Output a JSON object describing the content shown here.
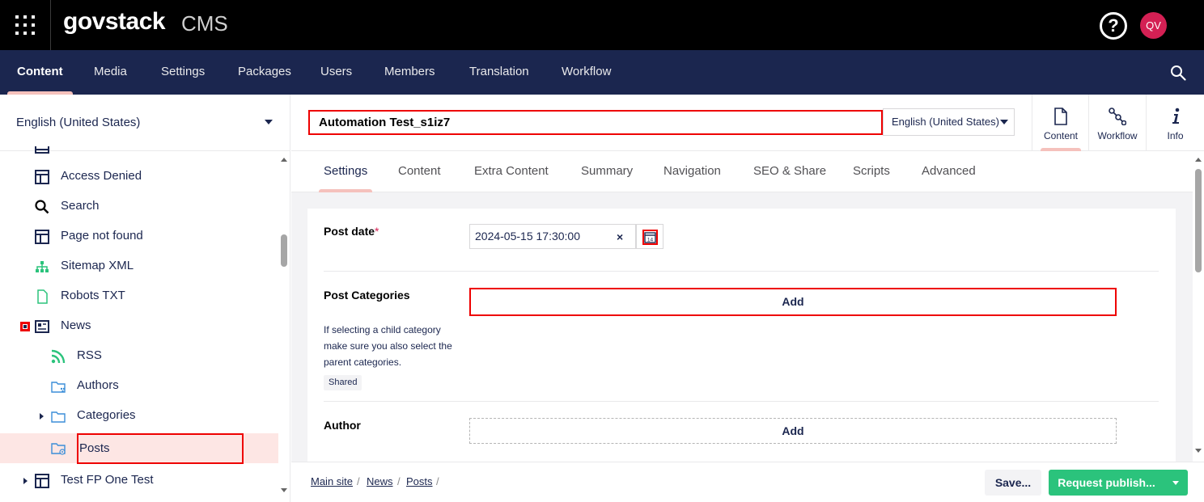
{
  "header": {
    "brand": "govstack",
    "product": "CMS",
    "help_symbol": "?",
    "avatar_initials": "QV",
    "avatar_color": "#d42054"
  },
  "sections": [
    "Content",
    "Media",
    "Settings",
    "Packages",
    "Users",
    "Members",
    "Translation",
    "Workflow"
  ],
  "active_section": "Content",
  "tree": {
    "culture": "English (United States)",
    "items": [
      {
        "label": "Access Denied",
        "icon": "layout-icon"
      },
      {
        "label": "Search",
        "icon": "search-icon"
      },
      {
        "label": "Page not found",
        "icon": "layout-icon"
      },
      {
        "label": "Sitemap XML",
        "icon": "sitemap-icon"
      },
      {
        "label": "Robots TXT",
        "icon": "document-icon"
      },
      {
        "label": "News",
        "icon": "newspaper-icon"
      },
      {
        "label": "RSS",
        "icon": "rss-icon"
      },
      {
        "label": "Authors",
        "icon": "folder-users-icon"
      },
      {
        "label": "Categories",
        "icon": "folder-icon"
      },
      {
        "label": "Posts",
        "icon": "folder-settings-icon"
      },
      {
        "label": "Test FP One Test",
        "icon": "layout-icon"
      }
    ],
    "selected": "Posts"
  },
  "editor": {
    "name": "Automation Test_s1iz7",
    "variant": "English (United States)",
    "apps": [
      "Content",
      "Workflow",
      "Info"
    ],
    "active_app": "Content",
    "tabs": [
      "Settings",
      "Content",
      "Extra Content",
      "Summary",
      "Navigation",
      "SEO & Share",
      "Scripts",
      "Advanced"
    ],
    "active_tab": "Settings"
  },
  "properties": {
    "post_date": {
      "label": "Post date",
      "required_mark": "*",
      "value": "2024-05-15 17:30:00",
      "clear_symbol": "×",
      "calendar_day": "14"
    },
    "post_categories": {
      "label": "Post Categories",
      "description": "If selecting a child category make sure you also select the parent categories.",
      "badge": "Shared",
      "add_label": "Add"
    },
    "author": {
      "label": "Author",
      "add_label": "Add"
    }
  },
  "footer": {
    "breadcrumb": [
      "Main site",
      "News",
      "Posts"
    ],
    "crumb_separator": "/",
    "save_label": "Save...",
    "publish_label": "Request publish..."
  },
  "colors": {
    "topbar": "#000000",
    "navbar": "#1b264f",
    "accent": "#f5c1bc",
    "highlight": "#ee0000",
    "publish": "#2bc37c"
  }
}
